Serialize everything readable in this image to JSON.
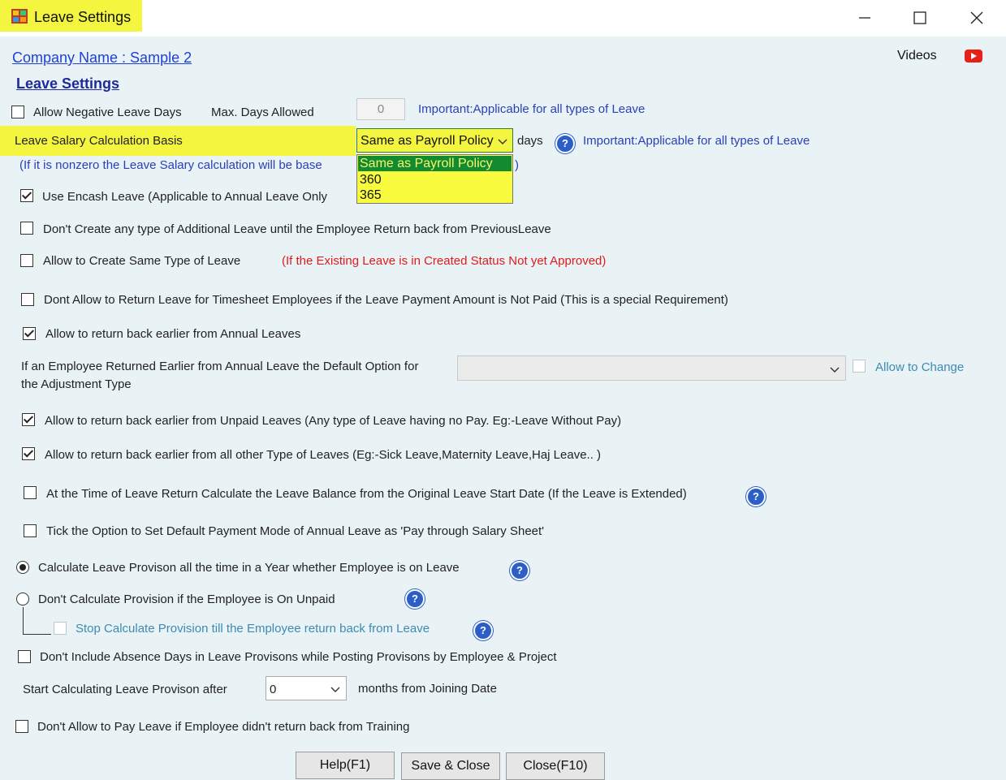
{
  "window": {
    "title": "Leave Settings"
  },
  "header": {
    "company_link": "Company Name : Sample 2",
    "videos_label": "Videos"
  },
  "section_title": "Leave Settings",
  "negative_leave": {
    "label": "Allow Negative Leave Days",
    "checked": false,
    "max_days_label": "Max. Days Allowed",
    "max_days_value": "0",
    "note": "Important:Applicable for all types of Leave"
  },
  "salary_basis": {
    "label": "Leave Salary Calculation Basis",
    "selected": "Same as Payroll Policy",
    "options": [
      "Same as Payroll Policy",
      "360",
      "365"
    ],
    "unit": "days",
    "note": "Important:Applicable for all types of Leave",
    "hint_start": "(If it is  nonzero the Leave Salary calculation will be base",
    "hint_end": ")"
  },
  "options": {
    "encash": "Use Encash Leave  (Applicable to Annual Leave Only",
    "no_additional": "Don't Create any type of Additional  Leave until the Employee Return back from PreviousLeave",
    "same_type": "Allow to Create Same Type of Leave",
    "same_type_note": "(If the Existing Leave is in Created Status Not yet Approved)",
    "timesheet": "Dont Allow to Return Leave for Timesheet Employees if the Leave Payment Amount is Not Paid (This is a special Requirement)",
    "return_annual": "Allow to return back earlier from Annual Leaves",
    "adjust_label_1": "If an Employee Returned Earlier from Annual Leave the Default Option for",
    "adjust_label_2": "the Adjustment Type",
    "allow_change": "Allow to Change",
    "return_unpaid": "Allow to return back earlier from Unpaid Leaves (Any type of Leave having no Pay. Eg:-Leave Without Pay)",
    "return_other": "Allow to return back earlier from all other Type of Leaves (Eg:-Sick Leave,Maternity Leave,Haj Leave.. )",
    "original_start": "At the Time of Leave Return Calculate the Leave Balance from the Original Leave Start Date (If the Leave is Extended)",
    "pay_salary_sheet": "Tick the Option to Set Default Payment Mode of Annual Leave as 'Pay through Salary Sheet'"
  },
  "provision": {
    "all_time": "Calculate Leave Provison all the time in a Year whether Employee is on Leave",
    "not_unpaid": "Don't Calculate Provision if the Employee is On Unpaid",
    "stop_till_return": "Stop Calculate Provision till the Employee return back from Leave",
    "exclude_absence": "Don't Include Absence Days in Leave Provisons while Posting Provisons by Employee & Project",
    "start_after_label": "Start Calculating Leave  Provison after",
    "start_after_value": "0",
    "start_after_unit": "months from Joining Date",
    "training": "Don't Allow to Pay Leave if Employee didn't return back from Training"
  },
  "buttons": {
    "help": "Help(F1)",
    "save_close": "Save & Close",
    "close": "Close(F10)"
  }
}
